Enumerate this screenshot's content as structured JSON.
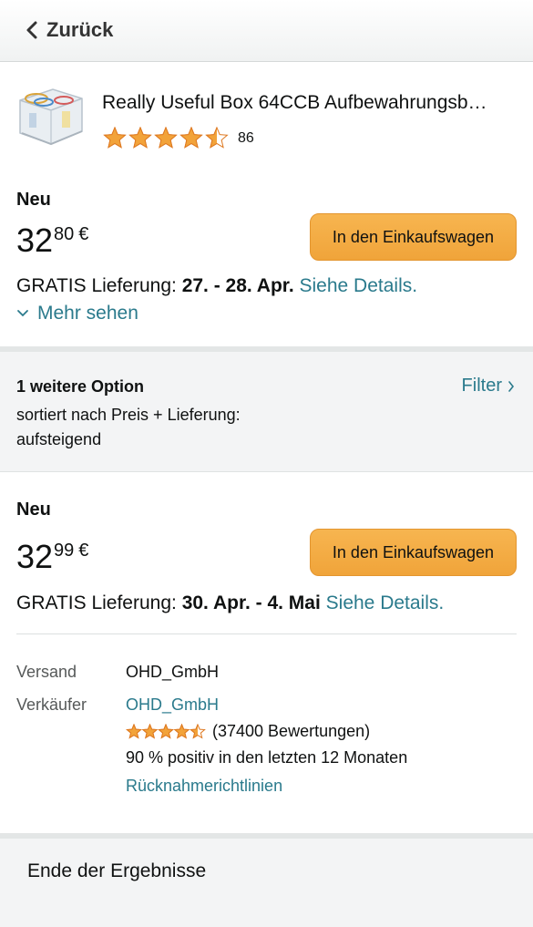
{
  "header": {
    "back_label": "Zurück"
  },
  "product": {
    "title": "Really Useful Box 64CCB Aufbewahrungsb…",
    "rating": 4.5,
    "rating_count": "86",
    "image_icon": "storage-box-image"
  },
  "main_offer": {
    "condition": "Neu",
    "price_whole": "32",
    "price_fraction": "80",
    "currency": "€",
    "cart_button": "In den Einkaufswagen",
    "delivery_prefix": "GRATIS Lieferung: ",
    "delivery_date": "27. - 28. Apr.",
    "details_link": "Siehe Details.",
    "more_link": "Mehr sehen"
  },
  "options_bar": {
    "title": "1 weitere Option",
    "sort_text": "sortiert nach Preis + Lieferung: aufsteigend",
    "filter_label": "Filter"
  },
  "offer": {
    "condition": "Neu",
    "price_whole": "32",
    "price_fraction": "99",
    "currency": "€",
    "cart_button": "In den Einkaufswagen",
    "delivery_prefix": "GRATIS Lieferung: ",
    "delivery_date": "30. Apr. - 4. Mai",
    "details_link": "Siehe Details.",
    "shipping_label": "Versand",
    "shipping_value": "OHD_GmbH",
    "seller_label": "Verkäufer",
    "seller_name": "OHD_GmbH",
    "seller_rating": 4.5,
    "seller_ratings_text": "(37400 Bewertungen)",
    "seller_positive_text": "90 % positiv in den letzten 12 Monaten",
    "return_policy_link": "Rücknahmerichtlinien"
  },
  "footer": {
    "end_text": "Ende der Ergebnisse"
  },
  "colors": {
    "accent_link": "#2a7a8c",
    "button": "#f0a43a",
    "star": "#f2a33a",
    "star_stroke": "#de7921"
  }
}
